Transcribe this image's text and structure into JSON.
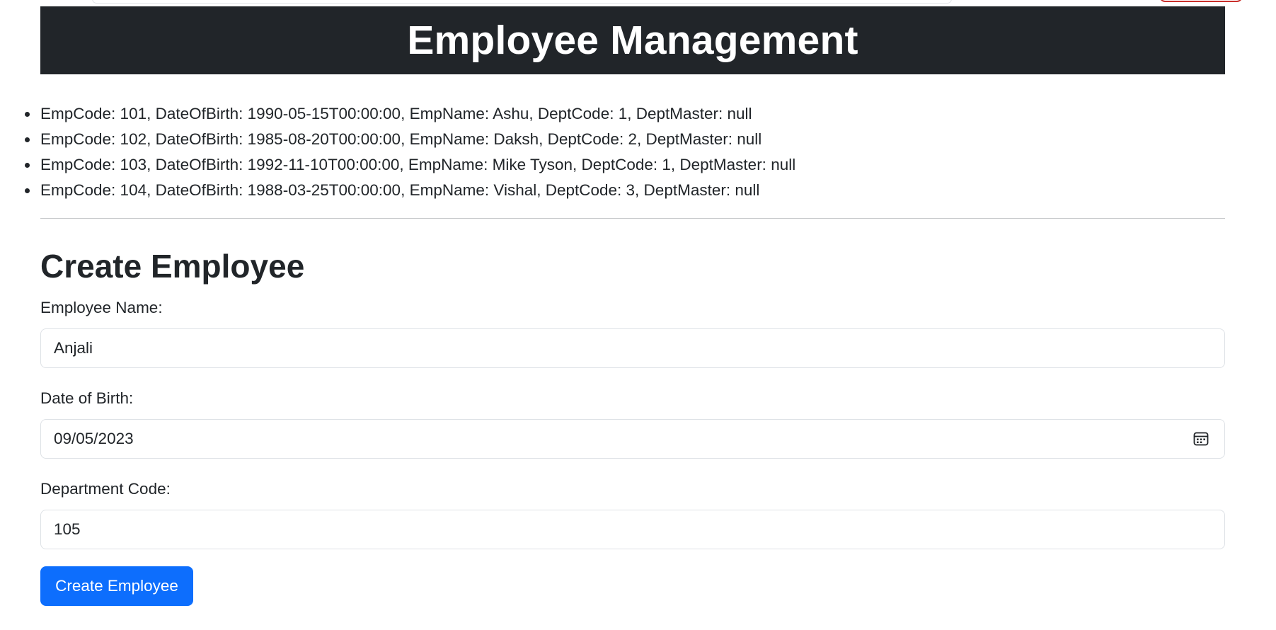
{
  "header": {
    "title": "Employee Management"
  },
  "employees": [
    "EmpCode: 101, DateOfBirth: 1990-05-15T00:00:00, EmpName: Ashu, DeptCode: 1, DeptMaster: null",
    "EmpCode: 102, DateOfBirth: 1985-08-20T00:00:00, EmpName: Daksh, DeptCode: 2, DeptMaster: null",
    "EmpCode: 103, DateOfBirth: 1992-11-10T00:00:00, EmpName: Mike Tyson, DeptCode: 1, DeptMaster: null",
    "EmpCode: 104, DateOfBirth: 1988-03-25T00:00:00, EmpName: Vishal, DeptCode: 3, DeptMaster: null"
  ],
  "form": {
    "title": "Create Employee",
    "name_label": "Employee Name:",
    "name_value": "Anjali",
    "dob_label": "Date of Birth:",
    "dob_value": "09/05/2023",
    "dept_label": "Department Code:",
    "dept_value": "105",
    "submit_label": "Create Employee"
  },
  "colors": {
    "header_bg": "#212529",
    "primary": "#0d6efd"
  },
  "icons": {
    "date_picker": "calendar-icon"
  }
}
